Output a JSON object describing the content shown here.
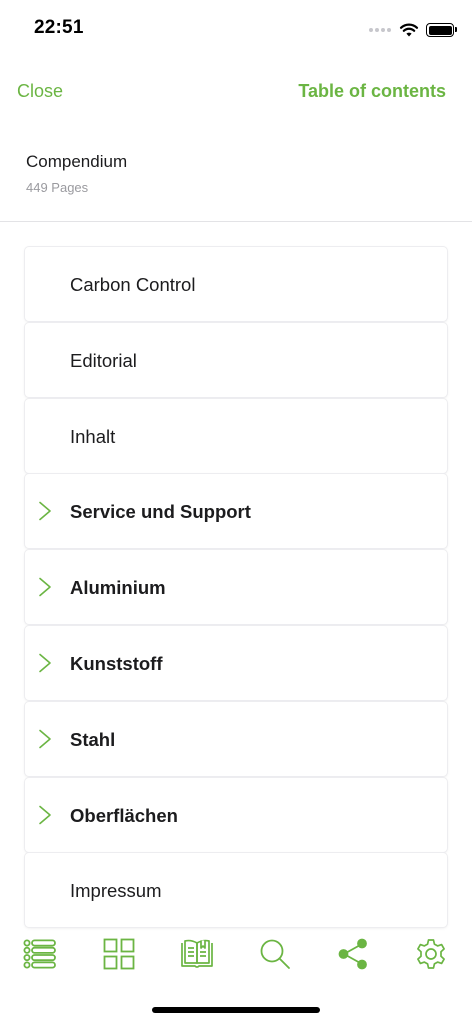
{
  "status_bar": {
    "time": "22:51"
  },
  "nav": {
    "close_label": "Close",
    "toc_label": "Table of contents"
  },
  "document": {
    "title": "Compendium",
    "pages": "449 Pages"
  },
  "toc": {
    "items": [
      {
        "label": "Carbon Control",
        "expandable": false
      },
      {
        "label": "Editorial",
        "expandable": false
      },
      {
        "label": "Inhalt",
        "expandable": false
      },
      {
        "label": "Service und Support",
        "expandable": true
      },
      {
        "label": "Aluminium",
        "expandable": true
      },
      {
        "label": "Kunststoff",
        "expandable": true
      },
      {
        "label": "Stahl",
        "expandable": true
      },
      {
        "label": "Oberflächen",
        "expandable": true
      },
      {
        "label": "Impressum",
        "expandable": false
      }
    ]
  },
  "tab_bar": {
    "icons": [
      "list-icon",
      "grid-icon",
      "book-icon",
      "search-icon",
      "share-icon",
      "settings-icon"
    ]
  },
  "colors": {
    "accent": "#6bb543",
    "text": "#1c1c1e",
    "secondary_text": "#9a9a9f",
    "divider": "#e3e3e6"
  }
}
